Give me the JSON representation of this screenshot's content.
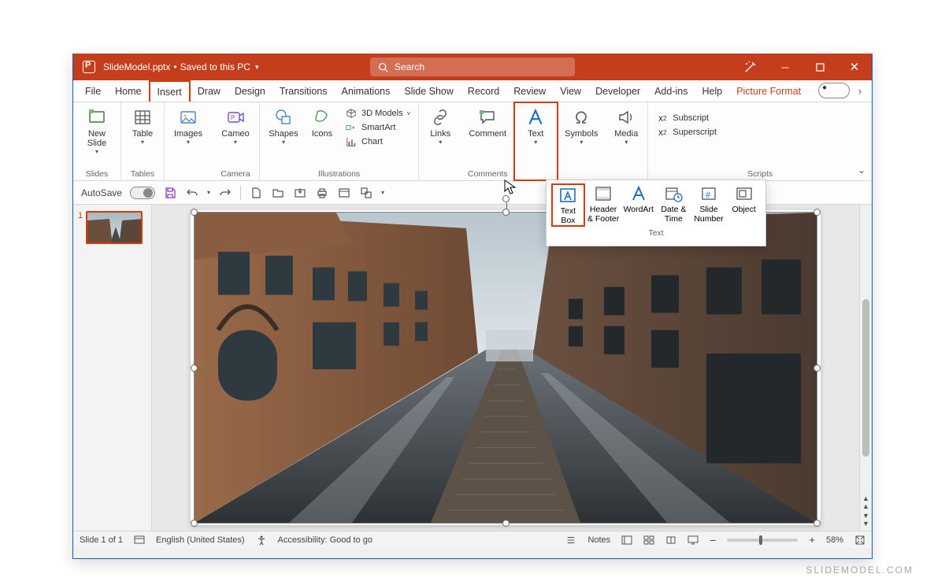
{
  "title": {
    "filename": "SlideModel.pptx",
    "saved_status": "Saved to this PC"
  },
  "search": {
    "placeholder": "Search"
  },
  "tabs": {
    "file": "File",
    "home": "Home",
    "insert": "Insert",
    "draw": "Draw",
    "design": "Design",
    "transitions": "Transitions",
    "animations": "Animations",
    "slideshow": "Slide Show",
    "record": "Record",
    "review": "Review",
    "view": "View",
    "developer": "Developer",
    "addins": "Add-ins",
    "help": "Help",
    "picture_format": "Picture Format"
  },
  "ribbon": {
    "new_slide": "New\nSlide",
    "slides": "Slides",
    "table": "Table",
    "tables": "Tables",
    "images": "Images",
    "cameo": "Cameo",
    "camera": "Camera",
    "shapes": "Shapes",
    "icons": "Icons",
    "models3d": "3D Models",
    "smartart": "SmartArt",
    "chart": "Chart",
    "illustrations": "Illustrations",
    "links": "Links",
    "comment": "Comment",
    "comments": "Comments",
    "text": "Text",
    "symbols": "Symbols",
    "media": "Media",
    "subscript": "Subscript",
    "superscript": "Superscript",
    "scripts": "Scripts"
  },
  "qat": {
    "autosave": "AutoSave"
  },
  "popup": {
    "text_box": "Text\nBox",
    "header_footer": "Header\n& Footer",
    "wordart": "WordArt",
    "date_time": "Date &\nTime",
    "slide_number": "Slide\nNumber",
    "object": "Object",
    "group": "Text"
  },
  "thumbnails": {
    "slide1_num": "1"
  },
  "statusbar": {
    "slide_of": "Slide 1 of 1",
    "language": "English (United States)",
    "accessibility": "Accessibility: Good to go",
    "notes": "Notes",
    "zoom": "58%"
  },
  "watermark": "SLIDEMODEL.COM"
}
